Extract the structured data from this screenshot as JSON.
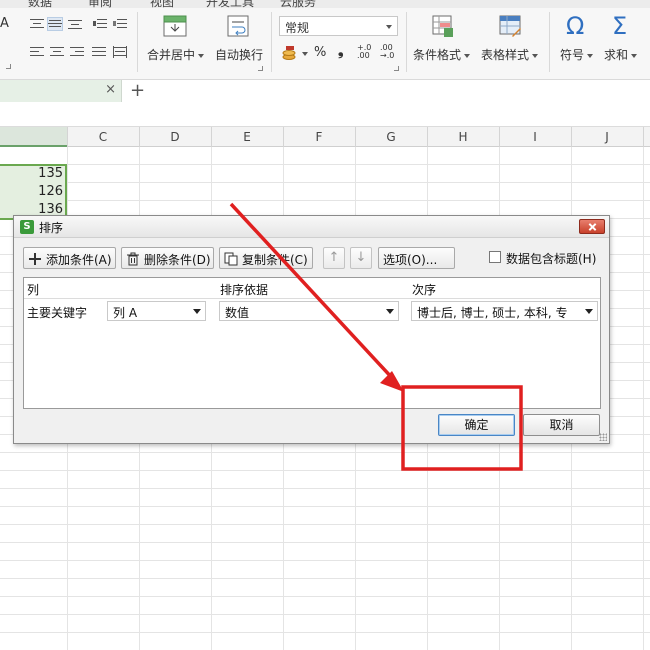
{
  "ribbon": {
    "merge_label": "合并居中",
    "wrap_label": "自动换行",
    "number_format": "常规",
    "percent_symbol": "%",
    "comma_symbol": "❟",
    "inc_decimal": ".00→.0",
    "dec_decimal": ".0→.00",
    "conditional_format_label": "条件格式",
    "table_style_label": "表格样式",
    "symbol_label": "符号",
    "sum_label": "求和",
    "symbol_glyph": "Ω",
    "sum_glyph": "Σ",
    "font_letter": "A",
    "clipped_tabs": [
      "数据",
      "审阅",
      "视图",
      "开发工具",
      "云服务"
    ]
  },
  "doc_tabs": {
    "close_glyph": "×",
    "new_tab_glyph": "+"
  },
  "sheet": {
    "columns": [
      "C",
      "D",
      "E",
      "F",
      "G",
      "H",
      "I",
      "J"
    ],
    "visible_values": [
      "135",
      "126",
      "136"
    ]
  },
  "sort_dialog": {
    "app_logo_letter": "S",
    "title": "排序",
    "add_condition": "添加条件(A)",
    "delete_condition": "删除条件(D)",
    "copy_condition": "复制条件(C)",
    "move_up": "↑",
    "move_down": "↓",
    "options": "选项(O)...",
    "header_checkbox_label": "数据包含标题(H)",
    "column_headers": {
      "column": "列",
      "sort_on": "排序依据",
      "order": "次序"
    },
    "primary_key_label": "主要关键字",
    "primary_column": "列 A",
    "sort_basis": "数值",
    "order_value": "博士后, 博士, 硕士, 本科, 专",
    "ok": "确定",
    "cancel": "取消"
  },
  "colors": {
    "selection_fill": "#e4efe0",
    "selection_border": "#6aa84f",
    "annotation_red": "#e02020",
    "close_button_red": "#c8412b"
  }
}
